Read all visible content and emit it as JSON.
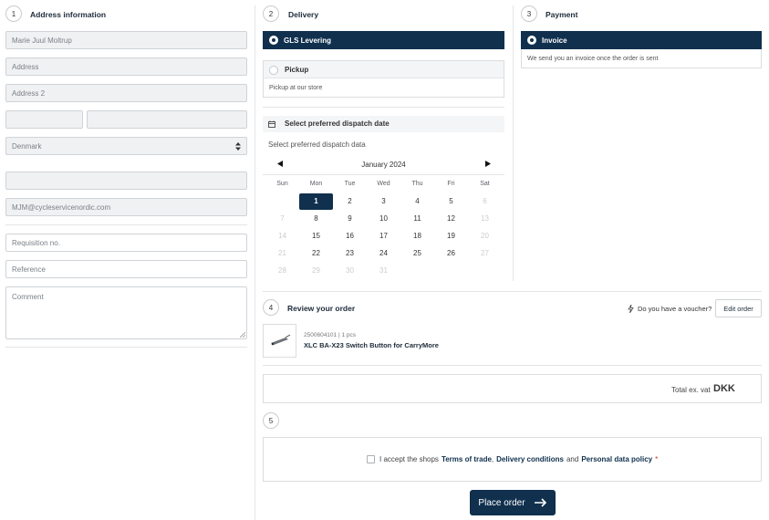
{
  "address": {
    "step": "1",
    "title": "Address information",
    "name_value": "Marie Juul Moltrup",
    "address_placeholder": "Address",
    "address2_placeholder": "Address 2",
    "zip_value": "",
    "city_value": "",
    "country_selected": "Denmark",
    "phone_value": "",
    "email_value": "MJM@cycleservicenordic.com",
    "requisition_placeholder": "Requisition no.",
    "reference_placeholder": "Reference",
    "comment_placeholder": "Comment"
  },
  "delivery": {
    "step": "2",
    "title": "Delivery",
    "options": [
      {
        "label": "GLS Levering",
        "selected": true
      },
      {
        "label": "Pickup",
        "selected": false,
        "description": "Pickup at our store"
      }
    ],
    "dispatch_title": "Select preferred dispatch date",
    "dispatch_placeholder": "Select preferred dispatch data",
    "calendar": {
      "month_label": "January 2024",
      "weekdays": [
        "Sun",
        "Mon",
        "Tue",
        "Wed",
        "Thu",
        "Fri",
        "Sat"
      ],
      "selected_day": "1",
      "rows": [
        [
          "",
          "1",
          "2",
          "3",
          "4",
          "5",
          "6"
        ],
        [
          "7",
          "8",
          "9",
          "10",
          "11",
          "12",
          "13"
        ],
        [
          "14",
          "15",
          "16",
          "17",
          "18",
          "19",
          "20"
        ],
        [
          "21",
          "22",
          "23",
          "24",
          "25",
          "26",
          "27"
        ],
        [
          "28",
          "29",
          "30",
          "31",
          "",
          "",
          ""
        ]
      ],
      "disabled": [
        "6",
        "7",
        "13",
        "14",
        "20",
        "21",
        "27",
        "28",
        "29",
        "30",
        "31"
      ]
    }
  },
  "payment": {
    "step": "3",
    "title": "Payment",
    "option_label": "Invoice",
    "option_description": "We send you an invoice once the order is sent"
  },
  "review": {
    "step": "4",
    "title": "Review your order",
    "voucher_text": "Do you have a voucher?",
    "edit_label": "Edit order",
    "item_meta": "2500604101 | 1 pcs",
    "item_name": "XLC BA-X23 Switch Button for CarryMore",
    "total_label": "Total ex. vat",
    "currency": "DKK"
  },
  "terms": {
    "step": "5",
    "prefix": "I accept the shops",
    "terms_link": "Terms of trade",
    "comma": ",",
    "delivery_link": "Delivery conditions",
    "and": "and",
    "privacy_link": "Personal data policy",
    "required": "*"
  },
  "place_order_label": "Place order",
  "colors": {
    "primary": "#10304e",
    "border": "#dadde0",
    "field_bg": "#f0f1f2"
  }
}
